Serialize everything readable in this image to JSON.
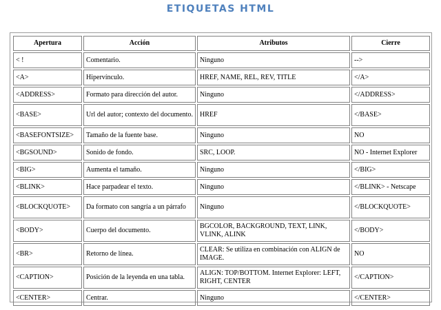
{
  "page": {
    "title": "ETIQUETAS HTML"
  },
  "table": {
    "headers": [
      "Apertura",
      "Acción",
      "Atributos",
      "Cierre"
    ],
    "rows": [
      [
        "< !",
        "Comentario.",
        "Ninguno",
        "-->"
      ],
      [
        "<A>",
        "Hipervínculo.",
        "HREF, NAME, REL, REV, TITLE",
        "</A>"
      ],
      [
        "<ADDRESS>",
        "Formato para dirección del autor.",
        "Ninguno",
        "</ADDRESS>"
      ],
      [
        "<BASE>",
        "Url del autor; contexto del documento.",
        "HREF",
        "</BASE>"
      ],
      [
        "<BASEFONTSIZE>",
        "Tamaño de la fuente base.",
        "Ninguno",
        "NO"
      ],
      [
        "<BGSOUND>",
        "Sonido de fondo.",
        "SRC, LOOP.",
        "NO - Internet Explorer"
      ],
      [
        "<BIG>",
        "Aumenta el tamaño.",
        "Ninguno",
        "</BIG>"
      ],
      [
        "<BLINK>",
        "Hace parpadear el texto.",
        "Ninguno",
        "</BLINK> - Netscape"
      ],
      [
        "<BLOCKQUOTE>",
        "Da formato con sangría a un párrafo",
        "Ninguno",
        "</BLOCKQUOTE>"
      ],
      [
        "<BODY>",
        "Cuerpo del documento.",
        "BGCOLOR, BACKGROUND, TEXT, LINK, VLINK, ALINK",
        "</BODY>"
      ],
      [
        "<BR>",
        "Retorno de línea.",
        "CLEAR: Se utiliza en combinación con ALIGN de IMAGE.",
        "NO"
      ],
      [
        "<CAPTION>",
        "Posición de la leyenda en una tabla.",
        "ALIGN: TOP/BOTTOM. Internet Explorer: LEFT, RIGHT, CENTER",
        "</CAPTION>"
      ],
      [
        "<CENTER>",
        "Centrar.",
        "Ninguno",
        "</CENTER>"
      ]
    ]
  },
  "colors": {
    "title": "#4f81bd",
    "border": "#808080"
  }
}
